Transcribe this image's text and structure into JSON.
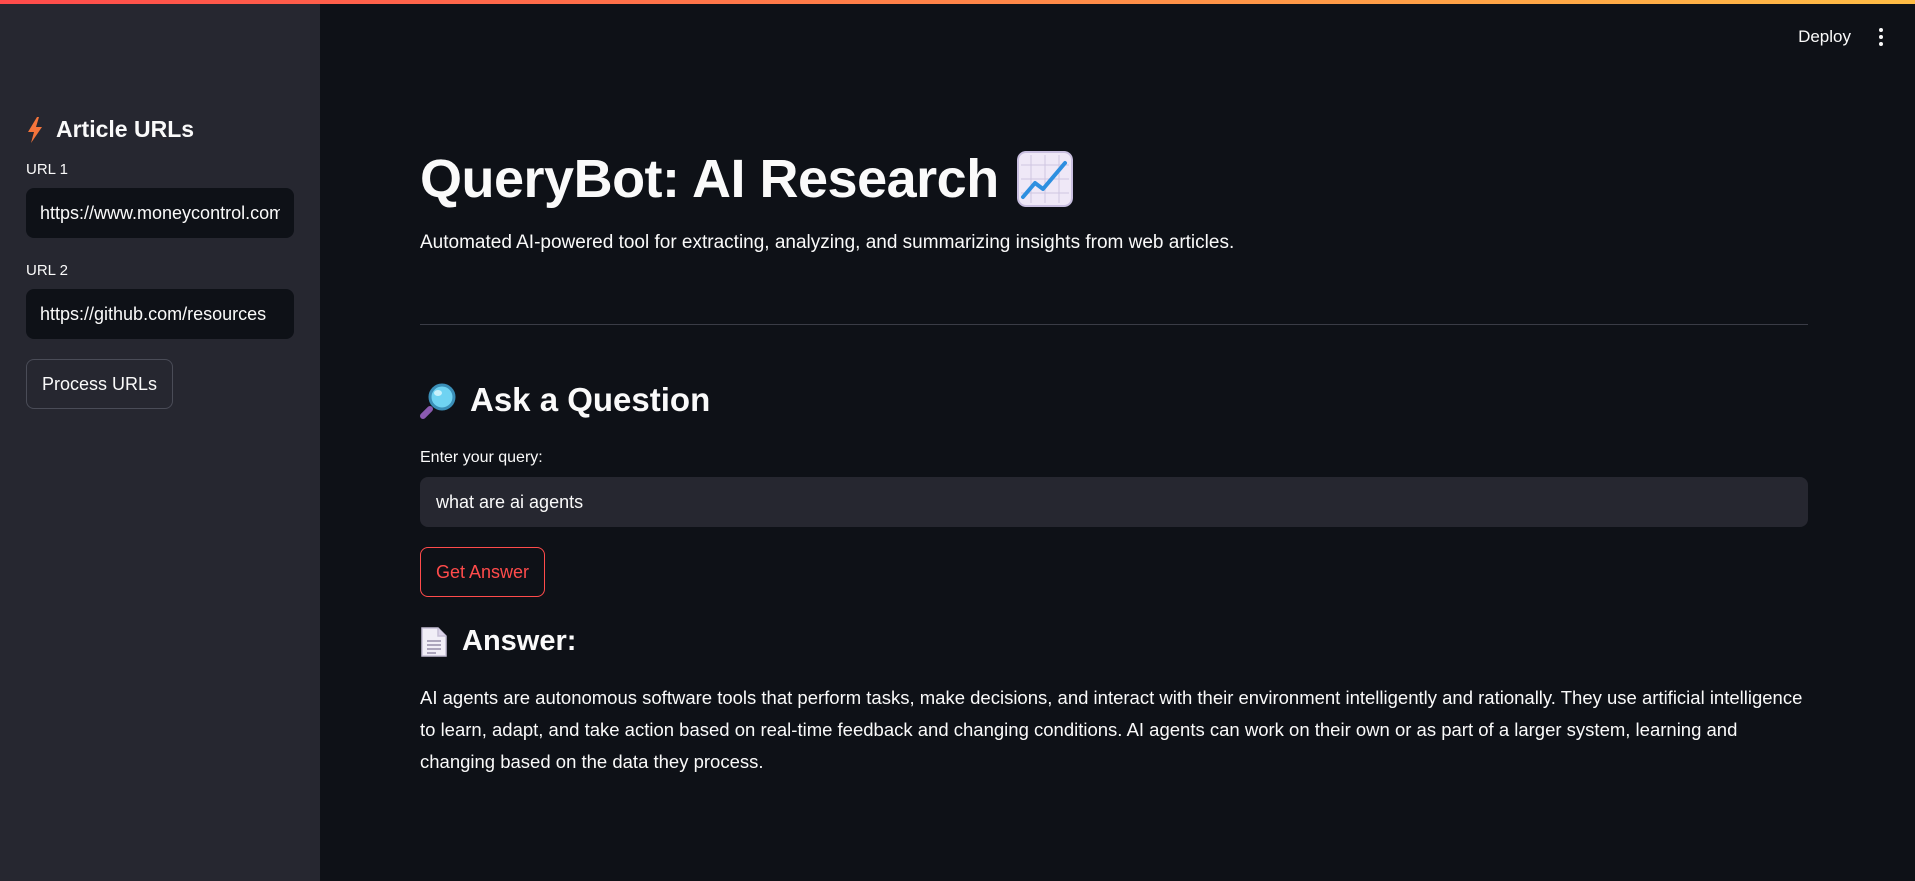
{
  "sidebar": {
    "header": "Article URLs",
    "header_icon": "lightning-bolt-icon",
    "urls": [
      {
        "label": "URL 1",
        "value": "https://www.moneycontrol.com"
      },
      {
        "label": "URL 2",
        "value": "https://github.com/resources"
      }
    ],
    "process_button": "Process URLs"
  },
  "toolbar": {
    "deploy_label": "Deploy",
    "menu_icon": "kebab-menu-icon"
  },
  "main": {
    "title": "QueryBot: AI Research",
    "title_icon": "chart-increasing-icon",
    "subtitle": "Automated AI-powered tool for extracting, analyzing, and summarizing insights from web articles.",
    "ask_header": "Ask a Question",
    "ask_icon": "magnifying-glass-icon",
    "query_label": "Enter your query:",
    "query_value": "what are ai agents",
    "answer_button": "Get Answer",
    "answer_header": "Answer:",
    "answer_icon": "document-icon",
    "answer_text": "AI agents are autonomous software tools that perform tasks, make decisions, and interact with their environment intelligently and rationally. They use artificial intelligence to learn, adapt, and take action based on real-time feedback and changing conditions. AI agents can work on their own or as part of a larger system, learning and changing based on the data they process."
  },
  "colors": {
    "background": "#0e1117",
    "sidebar": "#262730",
    "accent": "#ff4b4b",
    "text": "#fafafa"
  }
}
